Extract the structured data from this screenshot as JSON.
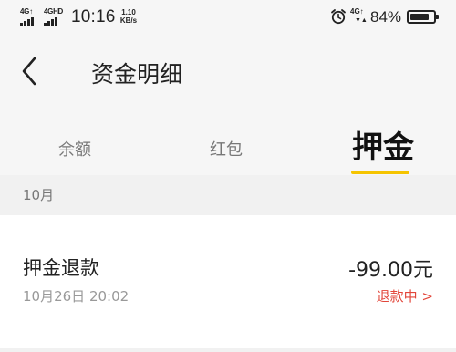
{
  "status_bar": {
    "sim1_network": "4G↑",
    "sim2_network": "4GHD",
    "time": "10:16",
    "speed_value": "1.10",
    "speed_unit": "KB/s",
    "right_network": "4G↑",
    "right_arrows": "▼▲",
    "battery_percent": "84%",
    "battery_level": 0.84,
    "icons": [
      "signal-icon",
      "alarm-icon",
      "battery-icon"
    ]
  },
  "header": {
    "back_icon": "chevron-left-icon",
    "title": "资金明细"
  },
  "tabs": [
    {
      "label": "余额",
      "active": false
    },
    {
      "label": "红包",
      "active": false
    },
    {
      "label": "押金",
      "active": true
    }
  ],
  "colors": {
    "tab_indicator": "#f5c400",
    "refund_status": "#e2463a",
    "background_gray": "#f6f6f6"
  },
  "records": {
    "month": "10月",
    "items": [
      {
        "title": "押金退款",
        "time": "10月26日 20:02",
        "amount": "-99.00元",
        "status": "退款中 >"
      }
    ]
  }
}
